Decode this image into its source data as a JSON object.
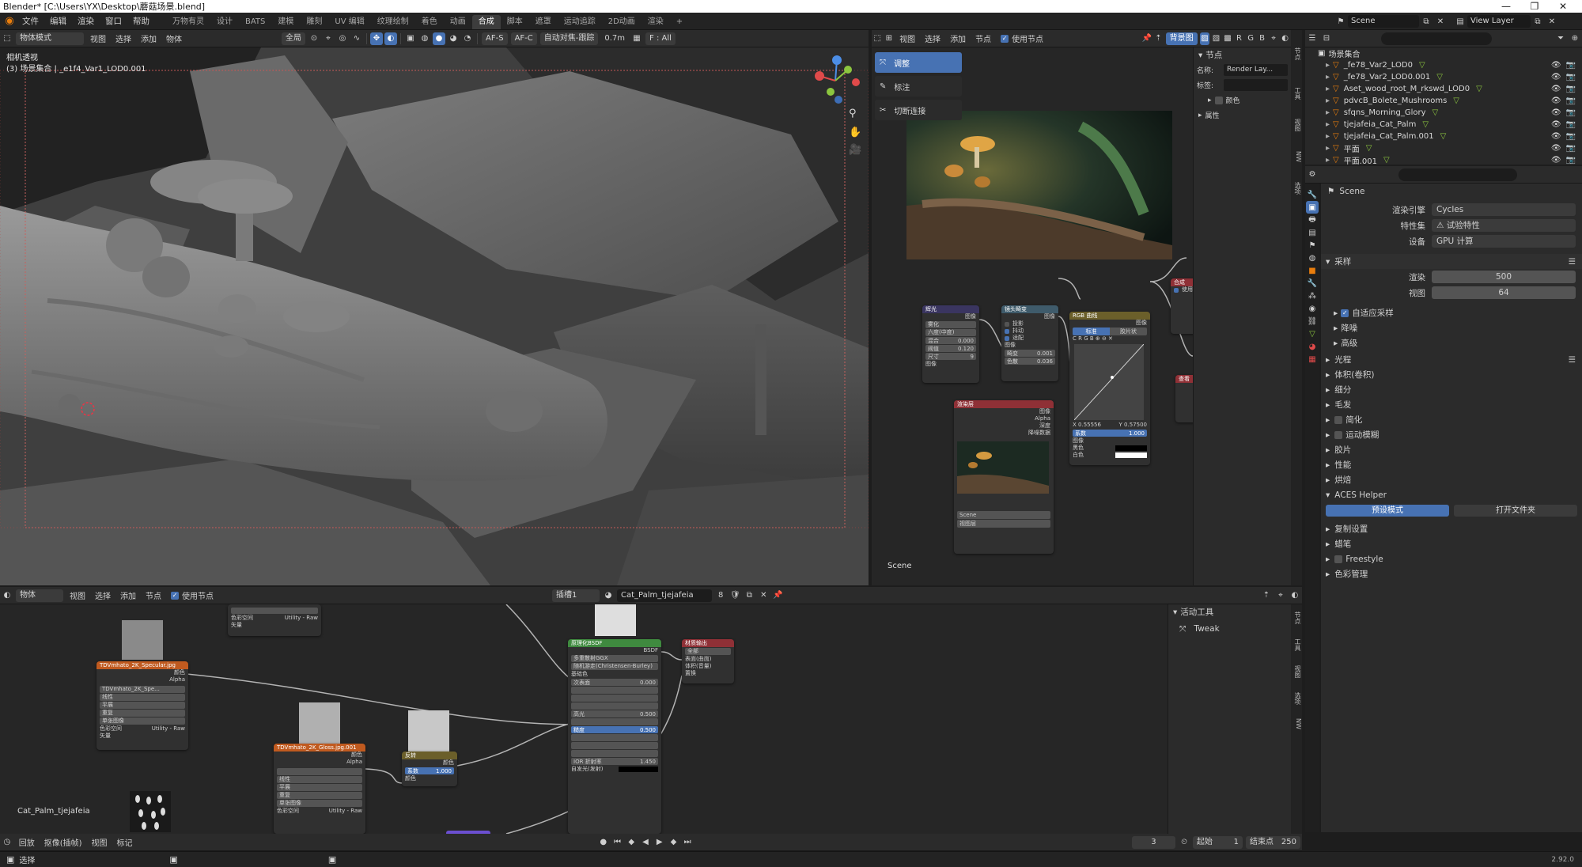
{
  "window": {
    "title": "Blender* [C:\\Users\\YX\\Desktop\\蘑菇场景.blend]",
    "min": "—",
    "max": "❐",
    "close": "✕"
  },
  "menubar": {
    "items": [
      "文件",
      "编辑",
      "渲染",
      "窗口",
      "帮助"
    ]
  },
  "workspaces": {
    "tabs": [
      "万物有灵",
      "设计",
      "BATS",
      "建模",
      "雕刻",
      "UV 编辑",
      "纹理绘制",
      "着色",
      "动画",
      "合成",
      "脚本",
      "遮罩",
      "运动追踪",
      "2D动画",
      "渲染"
    ],
    "active": 9,
    "add": "+"
  },
  "scene": {
    "icon": "scene-icon",
    "name": "Scene",
    "view_layer": "View Layer"
  },
  "viewport": {
    "mode": "物体模式",
    "menus": [
      "视图",
      "选择",
      "添加",
      "物体"
    ],
    "transform": "全局",
    "af_s": "AF-S",
    "af_c": "AF-C",
    "autofocus": "自动对焦-跟踪",
    "distance": "0.7m",
    "focus": "F : All",
    "overlay_title": "相机透视",
    "overlay_subtitle": "(3) 场景集合 | _e1f4_Var1_LOD0.001"
  },
  "compositor": {
    "menus": [
      "视图",
      "选择",
      "添加",
      "节点"
    ],
    "use_nodes": "使用节点",
    "backdrop": "背景图",
    "tools": [
      "调整",
      "标注",
      "切断连接"
    ],
    "scene_label": "Scene",
    "side_panel": {
      "header": "节点",
      "name_label": "名称:",
      "name_value": "Render Lay...",
      "tag_label": "标签:",
      "color": "颜色",
      "props": "属性"
    },
    "nodes": {
      "glare": "辉光",
      "glare_type": "雾化",
      "quality": "六度(中度)",
      "mix": "混合",
      "mix_val": "0.000",
      "threshold": "阈值",
      "threshold_val": "0.120",
      "size": "尺寸",
      "size_val": "9",
      "img": "图像",
      "lens": "镜头畸变",
      "proj": "投影",
      "jitter": "抖动",
      "fit": "适配",
      "distort": "畸变",
      "distort_val": "0.001",
      "disperse": "色散",
      "disperse_val": "0.036",
      "rgb": "RGB 曲线",
      "std": "标准",
      "film": "胶片状",
      "curve_x": "X 0.55556",
      "curve_y": "Y 0.57500",
      "factor": "系数",
      "factor_val": "1.000",
      "black": "黑色",
      "white": "白色",
      "render_layers": "渲染层",
      "alpha": "Alpha",
      "depth": "深度",
      "denoise": "降噪数据",
      "rl_scene": "Scene",
      "rl_view": "视图层",
      "comp": "合成",
      "use_alpha": "使用",
      "viewer": "查看"
    }
  },
  "outliner": {
    "collection": "场景集合",
    "items": [
      "_fe78_Var2_LOD0",
      "_fe78_Var2_LOD0.001",
      "Aset_wood_root_M_rkswd_LOD0",
      "pdvcB_Bolete_Mushrooms",
      "sfqns_Morning_Glory",
      "tjejafeia_Cat_Palm",
      "tjejafeia_Cat_Palm.001",
      "平面",
      "平面.001"
    ]
  },
  "properties": {
    "scene": "Scene",
    "engine_label": "渲染引擎",
    "engine": "Cycles",
    "feature_label": "特性集",
    "feature": "试验特性",
    "device_label": "设备",
    "device": "GPU 计算",
    "sampling": "采样",
    "render_label": "渲染",
    "render": "500",
    "view_label": "视图",
    "view": "64",
    "adaptive": "自适应采样",
    "denoise": "降噪",
    "advanced": "高级",
    "sections_a": [
      "光程",
      "体积(卷积)",
      "细分",
      "毛发"
    ],
    "simplify": "简化",
    "motion_blur": "运动模糊",
    "sections_b": [
      "胶片",
      "性能",
      "烘焙"
    ],
    "aces": "ACES Helper",
    "aces_btn1": "预设模式",
    "aces_btn2": "打开文件夹",
    "sections_c": [
      "复制设置",
      "蜡笔"
    ],
    "freestyle": "Freestyle",
    "color_mgmt": "色彩管理"
  },
  "shader": {
    "mode": "物体",
    "menus": [
      "视图",
      "选择",
      "添加",
      "节点"
    ],
    "use_nodes": "使用节点",
    "slot": "插槽1",
    "material": "Cat_Palm_tjejafeia",
    "users": "8",
    "object_label": "Cat_Palm_tjejafeia",
    "active_tool": "活动工具",
    "tool": "Tweak",
    "nodes": {
      "tex1": "TDVmhato_2K_Specular.jpg",
      "tex2": "TDVmhato_2K_Gloss.jpg.001",
      "tex_file": "TDVmhato_2K_Spe...",
      "color": "颜色",
      "alpha": "Alpha",
      "linear": "线性",
      "flat": "平展",
      "repeat": "重复",
      "single": "单张图像",
      "colorspace": "色彩空间",
      "utility": "Utility - Raw",
      "vector": "矢量",
      "invert": "反转",
      "factor": "系数",
      "factor_val": "1.000",
      "bsdf": "原理化BSDF",
      "bsdf_out": "BSDF",
      "ggx": "多重散射GGX",
      "rand": "随机游走(Christensen-Burley)",
      "base": "基础色",
      "subsurface": "次表面",
      "sub_val": "0.000",
      "spec": "高光",
      "spec_val": "0.500",
      "rough": "糙度",
      "rough_val": "0.500",
      "ior": "IOR 折射率",
      "ior_val": "1.450",
      "emit": "自发光(发射)",
      "output": "材质输出",
      "all": "全部",
      "surface": "表面(曲面)",
      "volume": "体积(音量)",
      "disp": "置换"
    }
  },
  "timeline": {
    "menus": [
      "回放",
      "抠像(插帧)",
      "视图",
      "标记"
    ],
    "frame": "3",
    "start_label": "起始",
    "start": "1",
    "end_label": "结束点",
    "end": "250"
  },
  "statusbar": {
    "select": "选择",
    "version": "2.92.0"
  },
  "colors": {
    "accent": "#4772b3",
    "orange": "#e87d0d",
    "header": "#2b2b2b",
    "panel": "#303030",
    "bg": "#1d1d1d"
  }
}
